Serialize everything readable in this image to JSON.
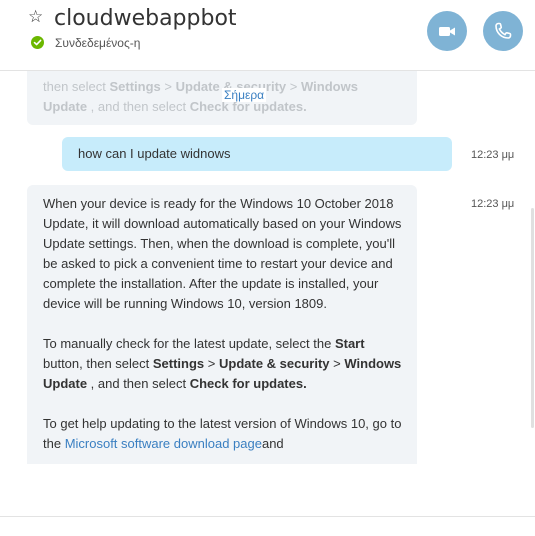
{
  "header": {
    "contact_name": "cloudwebappbot",
    "status": "Συνδεδεμένος-η"
  },
  "conversation": {
    "date_divider": "Σήμερα",
    "previous_message": {
      "prefix": "then select ",
      "settings": "Settings",
      "sep1": "  >  ",
      "update_security": "Update & security",
      "sep2": "  >  ",
      "windows": "Windows",
      "windows_update_tail": "Update",
      "middle": " , and then select ",
      "check": "Check for updates."
    },
    "user_message": {
      "text": "how can I update widnows",
      "time": "12:23 μμ"
    },
    "bot_message": {
      "time": "12:23 μμ",
      "p1": "When your device is ready for the Windows 10 October 2018 Update, it will download automatically based on your Windows Update settings. Then, when the download is complete, you'll be asked to pick a convenient time to restart your device    and complete the installation. After the update is installed, your device will be running Windows 10, version 1809.",
      "p2_prefix": "To manually check for the latest update, select the ",
      "p2_start": "Start",
      "p2_mid": " button, then select ",
      "p2_settings": "Settings",
      "p2_sep1": "  >  ",
      "p2_update_security": "Update & security",
      "p2_sep2": "  >  ",
      "p2_windows_update": "Windows Update",
      "p2_mid2": " , and then select ",
      "p2_check": "Check for updates.",
      "p3_prefix": "To get help updating to the latest version of Windows 10, go to the ",
      "p3_link": "Microsoft software download page",
      "p3_suffix": "and"
    }
  },
  "colors": {
    "accent_button": "#7fb3d5",
    "online": "#6bb700",
    "user_bubble": "#c7ecfb",
    "bot_bubble": "#f1f4f7",
    "link": "#3a7fc1"
  },
  "icons": {
    "favorite": "star-icon",
    "status": "online-check-icon",
    "video": "video-camera-icon",
    "call": "phone-icon"
  }
}
